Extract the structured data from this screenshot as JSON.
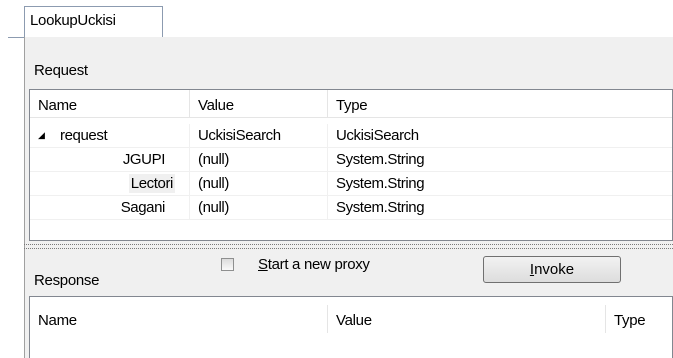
{
  "tab": {
    "label": "LookupUckisi"
  },
  "request": {
    "group_label": "Request",
    "columns": [
      "Name",
      "Value",
      "Type"
    ],
    "rows": [
      {
        "expander": "◢",
        "name": "request",
        "value": "UckisiSearch",
        "type": "UckisiSearch"
      },
      {
        "name": "JGUPI",
        "value": "(null)",
        "type": "System.String"
      },
      {
        "name": "Lectori",
        "value": "(null)",
        "type": "System.String"
      },
      {
        "name": "Sagani",
        "value": "(null)",
        "type": "System.String"
      }
    ]
  },
  "response": {
    "group_label": "Response",
    "columns": [
      "Name",
      "Value",
      "Type"
    ]
  },
  "controls": {
    "new_proxy_checkbox": {
      "label_accel": "S",
      "label_rest": "tart a new proxy",
      "checked": false
    },
    "invoke_button": {
      "label_accel": "I",
      "label_rest": "nvoke"
    }
  }
}
